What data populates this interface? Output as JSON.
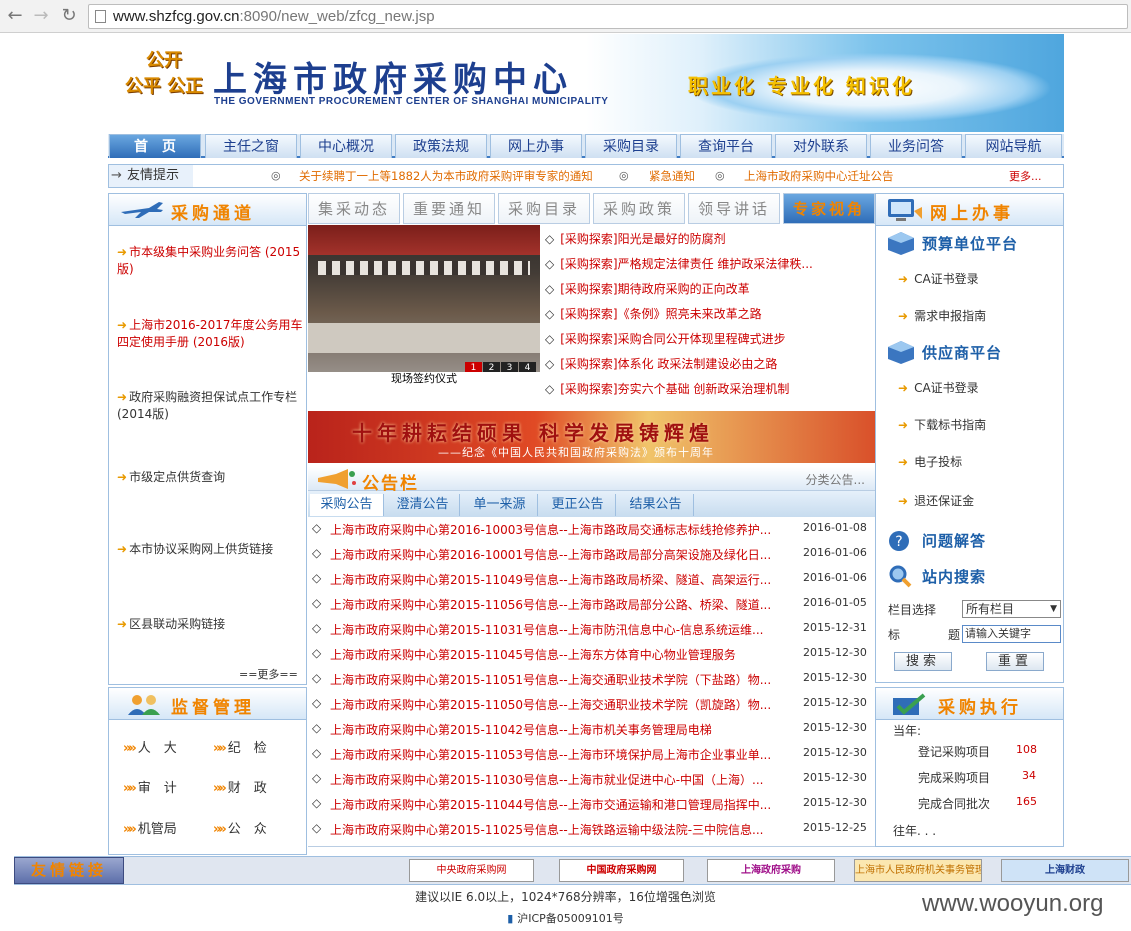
{
  "browser": {
    "url_host": "www.shzfcg.gov.cn",
    "url_path": ":8090/new_web/zfcg_new.jsp"
  },
  "header": {
    "logo_text": [
      "公开",
      "公平 公正"
    ],
    "title": "上海市政府采购中心",
    "subtitle": "THE GOVERNMENT PROCUREMENT CENTER OF SHANGHAI MUNICIPALITY",
    "slogan": "职业化 专业化 知识化"
  },
  "nav": [
    "首　页",
    "主任之窗",
    "中心概况",
    "政策法规",
    "网上办事",
    "采购目录",
    "查询平台",
    "对外联系",
    "业务问答",
    "网站导航"
  ],
  "ticker": {
    "label": "友情提示",
    "items": [
      "关于续聘丁一上等1882人为本市政府采购评审专家的通知",
      "紧急通知",
      "上海市政府采购中心迁址公告"
    ],
    "more": "更多..."
  },
  "procurement_channel": {
    "title": "采购通道",
    "items": [
      "市本级集中采购业务问答 (2015版)",
      "上海市2016-2017年度公务用车四定使用手册 (2016版)",
      "政府采购融资担保试点工作专栏 (2014版)",
      "市级定点供货查询",
      "本市协议采购网上供货链接",
      "区县联动采购链接"
    ],
    "more": "==更多=="
  },
  "supervision": {
    "title": "监督管理",
    "items": [
      "人　大",
      "纪　检",
      "审　计",
      "财　政",
      "机管局",
      "公　众"
    ]
  },
  "center_tabs": [
    "集采动态",
    "重要通知",
    "采购目录",
    "采购政策",
    "领导讲话",
    "专家视角"
  ],
  "photo": {
    "pages": [
      "1",
      "2",
      "3",
      "4"
    ],
    "caption": "现场签约仪式"
  },
  "expert_items": [
    "[采购探索]阳光是最好的防腐剂",
    "[采购探索]严格规定法律责任 维护政采法律秩...",
    "[采购探索]期待政府采购的正向改革",
    "[采购探索]《条例》照亮未来改革之路",
    "[采购探索]采购合同公开体现里程碑式进步",
    "[采购探索]体系化 政采法制建设必由之路",
    "[采购探索]夯实六个基础 创新政采治理机制"
  ],
  "promo": {
    "main": "十年耕耘结硕果 科学发展铸辉煌",
    "sub": "——纪念《中国人民共和国政府采购法》颁布十周年"
  },
  "bulletin": {
    "title": "公告栏",
    "more": "分类公告...",
    "tabs": [
      "采购公告",
      "澄清公告",
      "单一来源",
      "更正公告",
      "结果公告"
    ],
    "rows": [
      {
        "text": "上海市政府采购中心第2016-10003号信息--上海市路政局交通标志标线抢修养护...",
        "date": "2016-01-08"
      },
      {
        "text": "上海市政府采购中心第2016-10001号信息--上海市路政局部分高架设施及绿化日...",
        "date": "2016-01-06"
      },
      {
        "text": "上海市政府采购中心第2015-11049号信息--上海市路政局桥梁、隧道、高架运行...",
        "date": "2016-01-06"
      },
      {
        "text": "上海市政府采购中心第2015-11056号信息--上海市路政局部分公路、桥梁、隧道...",
        "date": "2016-01-05"
      },
      {
        "text": "上海市政府采购中心第2015-11031号信息--上海市防汛信息中心-信息系统运维...",
        "date": "2015-12-31"
      },
      {
        "text": "上海市政府采购中心第2015-11045号信息--上海东方体育中心物业管理服务",
        "date": "2015-12-30"
      },
      {
        "text": "上海市政府采购中心第2015-11051号信息--上海交通职业技术学院（下盐路）物...",
        "date": "2015-12-30"
      },
      {
        "text": "上海市政府采购中心第2015-11050号信息--上海交通职业技术学院（凯旋路）物...",
        "date": "2015-12-30"
      },
      {
        "text": "上海市政府采购中心第2015-11042号信息--上海市机关事务管理局电梯",
        "date": "2015-12-30"
      },
      {
        "text": "上海市政府采购中心第2015-11053号信息--上海市环境保护局上海市企业事业单...",
        "date": "2015-12-30"
      },
      {
        "text": "上海市政府采购中心第2015-11030号信息--上海市就业促进中心-中国（上海）...",
        "date": "2015-12-30"
      },
      {
        "text": "上海市政府采购中心第2015-11044号信息--上海市交通运输和港口管理局指挥中...",
        "date": "2015-12-30"
      },
      {
        "text": "上海市政府采购中心第2015-11025号信息--上海铁路运输中级法院-三中院信息...",
        "date": "2015-12-25"
      }
    ]
  },
  "online": {
    "title": "网上办事",
    "budget_title": "预算单位平台",
    "budget_links": [
      "CA证书登录",
      "需求申报指南"
    ],
    "supplier_title": "供应商平台",
    "supplier_links": [
      "CA证书登录",
      "下载标书指南",
      "电子投标",
      "退还保证金"
    ],
    "qa_title": "问题解答",
    "search_title": "站内搜索",
    "col_label": "栏目选择",
    "col_value": "所有栏目",
    "kw_label1": "标",
    "kw_label2": "题",
    "kw_value": "请输入关键字",
    "search_btn": "搜索",
    "reset_btn": "重置"
  },
  "execution": {
    "title": "采购执行",
    "this_year": "当年:",
    "rows": [
      {
        "label": "登记采购项目",
        "value": "108"
      },
      {
        "label": "完成采购项目",
        "value": "34"
      },
      {
        "label": "完成合同批次",
        "value": "165"
      }
    ],
    "past": "往年. . ."
  },
  "footer": {
    "links_label": "友情链接",
    "links": [
      "中央政府采购网",
      "中国政府采购网",
      "上海政府采购",
      "上海市人民政府机关事务管理局",
      "上海财政"
    ],
    "note": "建议以IE 6.0以上，1024*768分辨率，16位增强色浏览",
    "icp": "沪ICP备05009101号"
  },
  "watermark": "www.wooyun.org",
  "colors": {
    "accent_orange": "#f08400",
    "nav_blue": "#1d3f8f",
    "link_red": "#cc0000"
  }
}
